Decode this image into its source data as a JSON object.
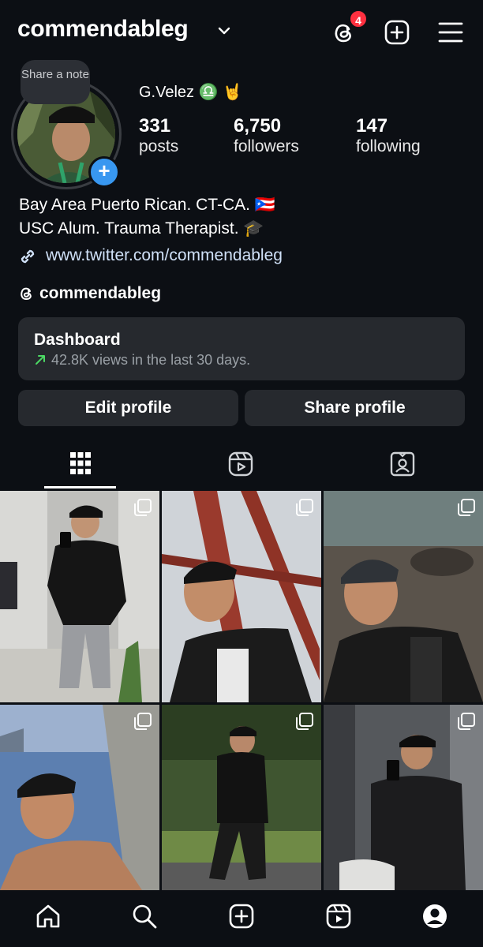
{
  "header": {
    "username": "commendableg",
    "threads_badge_count": "4"
  },
  "note": {
    "label": "Share a note"
  },
  "profile": {
    "display_name": "G.Velez ♎️ 🤘",
    "stats": [
      {
        "value": "331",
        "label": "posts"
      },
      {
        "value": "6,750",
        "label": "followers"
      },
      {
        "value": "147",
        "label": "following"
      }
    ],
    "bio_line1": "Bay Area Puerto Rican. CT-CA. 🇵🇷",
    "bio_line2": "USC Alum. Trauma Therapist. 🎓",
    "link": "www.twitter.com/commendableg",
    "threads_handle": "commendableg"
  },
  "dashboard": {
    "title": "Dashboard",
    "subtitle": "42.8K views in the last 30 days."
  },
  "actions": {
    "edit_profile": "Edit profile",
    "share_profile": "Share profile"
  },
  "tabs": [
    "posts-grid",
    "reels",
    "tagged"
  ],
  "grid": {
    "tiles": [
      {
        "scene": "mirror-selfie-bedroom",
        "multi": true
      },
      {
        "scene": "bridge-selfie",
        "multi": true
      },
      {
        "scene": "rocky-shore-selfie",
        "multi": true
      },
      {
        "scene": "waterfront-shirtless-selfie",
        "multi": true
      },
      {
        "scene": "running-park",
        "multi": true
      },
      {
        "scene": "mirror-selfie-dark",
        "multi": true
      }
    ]
  },
  "bottom_nav": [
    "home-icon",
    "search-icon",
    "create-icon",
    "reels-icon",
    "profile-icon"
  ],
  "colors": {
    "background": "#0c0f14",
    "card": "#26292e",
    "accent_blue": "#3897f0",
    "badge_red": "#ff3040",
    "link": "#cfe0f7",
    "trend_green": "#4cd964"
  }
}
